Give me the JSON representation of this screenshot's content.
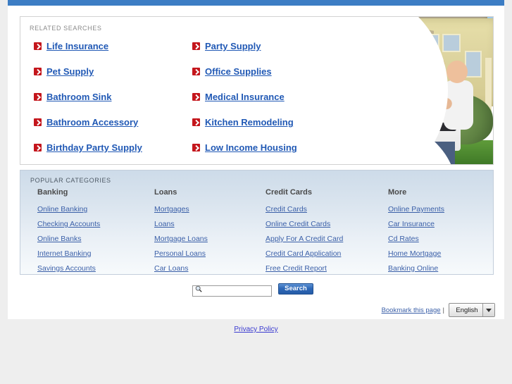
{
  "page": {
    "accent_blue": "#3c7dc4",
    "link_blue": "#2159b5",
    "bullet_red": "#c4161c"
  },
  "related_searches": {
    "title": "RELATED SEARCHES",
    "left_column": [
      "Life Insurance",
      "Pet Supply",
      "Bathroom Sink",
      "Bathroom Accessory",
      "Birthday Party Supply"
    ],
    "right_column": [
      "Party Supply",
      "Office Supplies",
      "Medical Insurance",
      "Kitchen Remodeling",
      "Low Income Housing"
    ],
    "photo_alt": "family-with-baby-in-front-of-house-photo"
  },
  "popular_categories": {
    "title": "POPULAR CATEGORIES",
    "columns": [
      {
        "heading": "Banking",
        "links": [
          "Online Banking",
          "Checking Accounts",
          "Online Banks",
          "Internet Banking",
          "Savings Accounts"
        ]
      },
      {
        "heading": "Loans",
        "links": [
          "Mortgages",
          "Loans",
          "Mortgage Loans",
          "Personal Loans",
          "Car Loans"
        ]
      },
      {
        "heading": "Credit Cards",
        "links": [
          "Credit Cards",
          "Online Credit Cards",
          "Apply For A Credit Card",
          "Credit Card Application",
          "Free Credit Report"
        ]
      },
      {
        "heading": "More",
        "links": [
          "Online Payments",
          "Car Insurance",
          "Cd Rates",
          "Home Mortgage",
          "Banking Online"
        ]
      }
    ]
  },
  "search": {
    "value": "",
    "placeholder": "",
    "button_label": "Search",
    "icon": "magnifier-icon"
  },
  "footer": {
    "bookmark_label": "Bookmark this page",
    "separator": "|",
    "language_selected": "English",
    "language_options": [
      "English"
    ],
    "privacy_label": "Privacy Policy"
  }
}
